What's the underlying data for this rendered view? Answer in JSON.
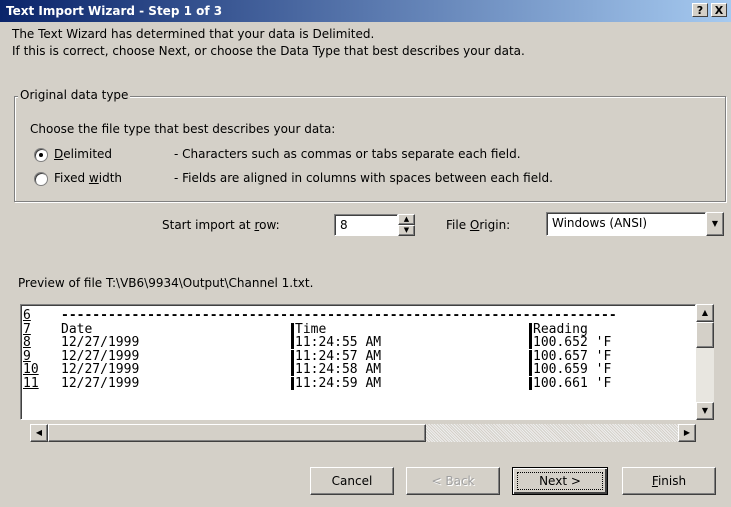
{
  "window": {
    "title": "Text Import Wizard - Step 1 of 3",
    "help_label": "?",
    "close_label": "X"
  },
  "intro": {
    "line1": "The Text Wizard has determined that your data is Delimited.",
    "line2": "If this is correct, choose Next, or choose the Data Type that best describes your data."
  },
  "original_data_type": {
    "legend": "Original data type",
    "prompt": "Choose the file type that best describes your data:",
    "options": [
      {
        "label_pre": "",
        "label_u": "D",
        "label_post": "elimited",
        "description": "- Characters such as commas or tabs separate each field.",
        "selected": true
      },
      {
        "label_pre": "Fixed ",
        "label_u": "w",
        "label_post": "idth",
        "description": "- Fields are aligned in columns with spaces between each field.",
        "selected": false
      }
    ]
  },
  "start_import": {
    "label_pre": "Start import at ",
    "label_u": "r",
    "label_post": "ow:",
    "value": "8"
  },
  "file_origin": {
    "label_pre": "File ",
    "label_u": "O",
    "label_post": "rigin:",
    "value": "Windows (ANSI)"
  },
  "preview": {
    "label": "Preview of file T:\\VB6\\9934\\Output\\Channel 1.txt.",
    "rows": [
      {
        "num": "6",
        "col1": "-----------------------------------------------------------------------",
        "col2": "",
        "col3": "",
        "dashed": true
      },
      {
        "num": "7",
        "col1": "Date",
        "col2": "Time",
        "col3": "Reading",
        "dashed": false
      },
      {
        "num": "8",
        "col1": "12/27/1999",
        "col2": "11:24:55 AM",
        "col3": "100.652 'F",
        "dashed": false
      },
      {
        "num": "9",
        "col1": "12/27/1999",
        "col2": "11:24:57 AM",
        "col3": "100.657 'F",
        "dashed": false
      },
      {
        "num": "10",
        "col1": "12/27/1999",
        "col2": "11:24:58 AM",
        "col3": "100.659 'F",
        "dashed": false
      },
      {
        "num": "11",
        "col1": "12/27/1999",
        "col2": "11:24:59 AM",
        "col3": "100.661 'F",
        "dashed": false
      }
    ]
  },
  "buttons": {
    "cancel": "Cancel",
    "back": "< Back",
    "next": "Next >",
    "finish_pre": "",
    "finish_u": "F",
    "finish_post": "inish"
  },
  "colors": {
    "title_start": "#0a246a",
    "title_end": "#a6caf0",
    "face": "#d4d0c8"
  }
}
